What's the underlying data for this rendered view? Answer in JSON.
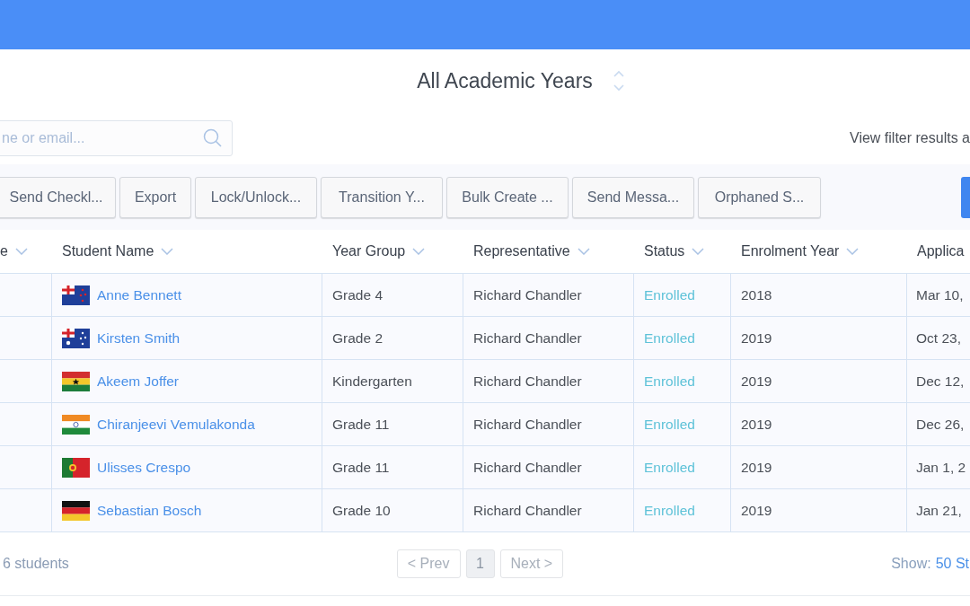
{
  "year_selector": {
    "label": "All Academic Years"
  },
  "search": {
    "placeholder": "ne or email..."
  },
  "filter_note": "View filter results a",
  "toolbar": [
    "Send Checkl...",
    "Export",
    "Lock/Unlock...",
    "Transition Y...",
    "Bulk Create ...",
    "Send Messa...",
    "Orphaned S..."
  ],
  "table": {
    "columns": [
      "e",
      "Student Name",
      "Year Group",
      "Representative",
      "Status",
      "Enrolment Year",
      "Applica"
    ],
    "rows": [
      {
        "kind": "nz",
        "name": "Anne Bennett",
        "year_group": "Grade 4",
        "representative": "Richard Chandler",
        "status": "Enrolled",
        "enrolment_year": "2018",
        "column_7": "Mar 10,"
      },
      {
        "kind": "au",
        "name": "Kirsten Smith",
        "year_group": "Grade 2",
        "representative": "Richard Chandler",
        "status": "Enrolled",
        "enrolment_year": "2019",
        "column_7": "Oct 23,"
      },
      {
        "kind": "gh",
        "name": "Akeem Joffer",
        "year_group": "Kindergarten",
        "representative": "Richard Chandler",
        "status": "Enrolled",
        "enrolment_year": "2019",
        "column_7": "Dec 12,"
      },
      {
        "kind": "in",
        "name": "Chiranjeevi Vemulakonda",
        "year_group": "Grade 11",
        "representative": "Richard Chandler",
        "status": "Enrolled",
        "enrolment_year": "2019",
        "column_7": "Dec 26,"
      },
      {
        "kind": "pt",
        "name": "Ulisses Crespo",
        "year_group": "Grade 11",
        "representative": "Richard Chandler",
        "status": "Enrolled",
        "enrolment_year": "2019",
        "column_7": "Jan 1, 2"
      },
      {
        "kind": "de",
        "name": "Sebastian Bosch",
        "year_group": "Grade 10",
        "representative": "Richard Chandler",
        "status": "Enrolled",
        "enrolment_year": "2019",
        "column_7": "Jan 21,"
      }
    ]
  },
  "footer": {
    "count": "6 students",
    "pagination": [
      {
        "label": "< Prev",
        "kind": "nav",
        "selected": false
      },
      {
        "label": "1",
        "kind": "page",
        "selected": true
      },
      {
        "label": "Next >",
        "kind": "nav",
        "selected": false
      }
    ],
    "show_label": "Show:",
    "show_value": "50 St"
  }
}
